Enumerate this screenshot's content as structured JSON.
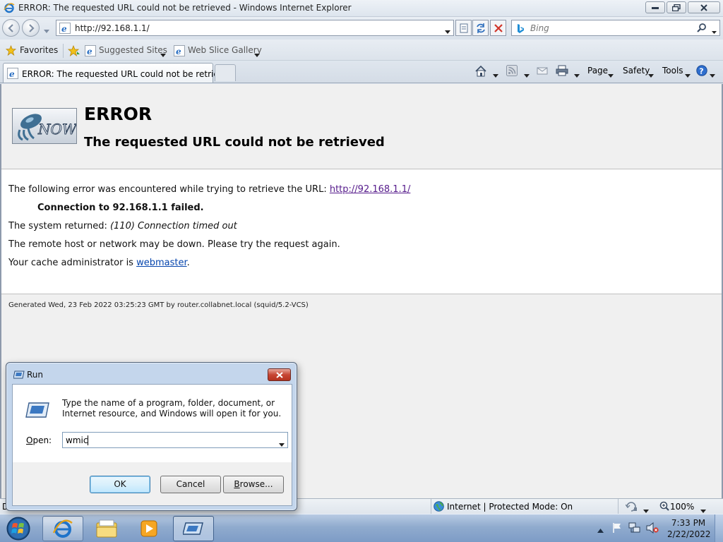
{
  "window": {
    "title": "ERROR: The requested URL could not be retrieved - Windows Internet Explorer"
  },
  "navigation": {
    "url": "http://92.168.1.1/",
    "search_placeholder": "Bing"
  },
  "favorites_bar": {
    "favorites_label": "Favorites",
    "suggested_sites_label": "Suggested Sites",
    "web_slice_gallery_label": "Web Slice Gallery"
  },
  "tabs": [
    {
      "label": "ERROR: The requested URL could not be retrieved"
    }
  ],
  "command_bar": {
    "page_label": "Page",
    "safety_label": "Safety",
    "tools_label": "Tools"
  },
  "page": {
    "heading": "ERROR",
    "subheading": "The requested URL could not be retrieved",
    "logo_text": "NOW",
    "error_intro": "The following error was encountered while trying to retrieve the URL: ",
    "error_url": "http://92.168.1.1/",
    "connection_failed": "Connection to 92.168.1.1 failed.",
    "system_returned_label": "The system returned: ",
    "system_returned_value": "(110) Connection timed out",
    "remote_host_msg": "The remote host or network may be down. Please try the request again.",
    "cache_admin_prefix": "Your cache administrator is ",
    "cache_admin_link": "webmaster",
    "cache_admin_suffix": ".",
    "generated": "Generated Wed, 23 Feb 2022 03:25:23 GMT by router.collabnet.local (squid/5.2-VCS)"
  },
  "status_bar": {
    "left_fragment": "D",
    "zone_text": "Internet | Protected Mode: On",
    "zoom": "100%"
  },
  "run_dialog": {
    "title": "Run",
    "description": "Type the name of a program, folder, document, or Internet resource, and Windows will open it for you.",
    "open_label_prefix": "O",
    "open_label_rest": "pen:",
    "input_value": "wmic",
    "ok_label": "OK",
    "cancel_label": "Cancel",
    "browse_label_prefix": "B",
    "browse_label_rest": "rowse..."
  },
  "taskbar": {
    "time": "7:33 PM",
    "date": "2/22/2022"
  },
  "colors": {
    "link_visited": "#551a8b",
    "link": "#0645ad",
    "close_button": "#c74634"
  }
}
